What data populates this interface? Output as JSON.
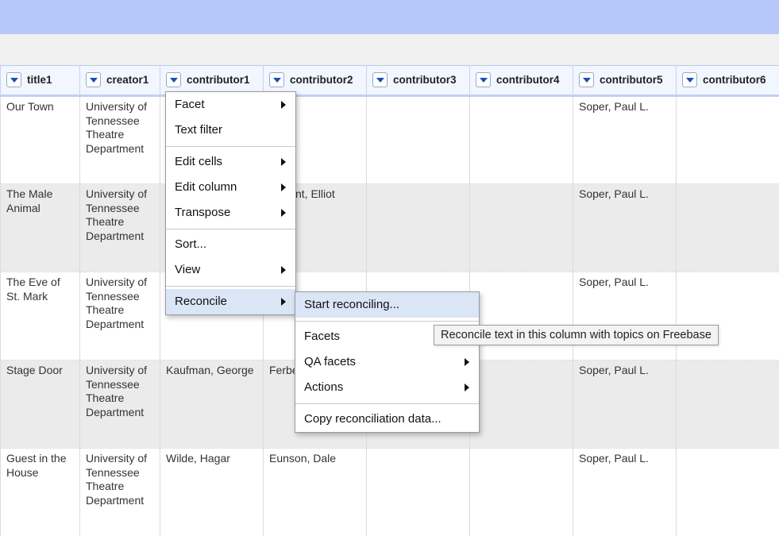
{
  "columns": [
    {
      "label": "title1"
    },
    {
      "label": "creator1"
    },
    {
      "label": "contributor1"
    },
    {
      "label": "contributor2"
    },
    {
      "label": "contributor3"
    },
    {
      "label": "contributor4"
    },
    {
      "label": "contributor5"
    },
    {
      "label": "contributor6"
    }
  ],
  "rows": [
    [
      "Our Town",
      "University of Tennessee Theatre Department",
      "",
      "",
      "",
      "",
      "Soper, Paul L.",
      ""
    ],
    [
      "The Male Animal",
      "University of Tennessee Theatre Department",
      "",
      "nt, Elliot",
      "",
      "",
      "Soper, Paul L.",
      ""
    ],
    [
      "The Eve of St. Mark",
      "University of Tennessee Theatre Department",
      "",
      "",
      "",
      "",
      "Soper, Paul L.",
      ""
    ],
    [
      "Stage Door",
      "University of Tennessee Theatre Department",
      "Kaufman, George",
      "Ferbe",
      "",
      "",
      "Soper, Paul L.",
      ""
    ],
    [
      "Guest in the House",
      "University of Tennessee Theatre Department",
      "Wilde, Hagar",
      "Eunson, Dale",
      "",
      "",
      "Soper, Paul L.",
      ""
    ]
  ],
  "column_menu": {
    "facet": "Facet",
    "text_filter": "Text filter",
    "edit_cells": "Edit cells",
    "edit_column": "Edit column",
    "transpose": "Transpose",
    "sort": "Sort...",
    "view": "View",
    "reconcile": "Reconcile"
  },
  "reconcile_menu": {
    "start": "Start reconciling...",
    "facets": "Facets",
    "qa_facets": "QA facets",
    "actions": "Actions",
    "copy": "Copy reconciliation data..."
  },
  "tooltip": "Reconcile text in this column with topics on Freebase"
}
